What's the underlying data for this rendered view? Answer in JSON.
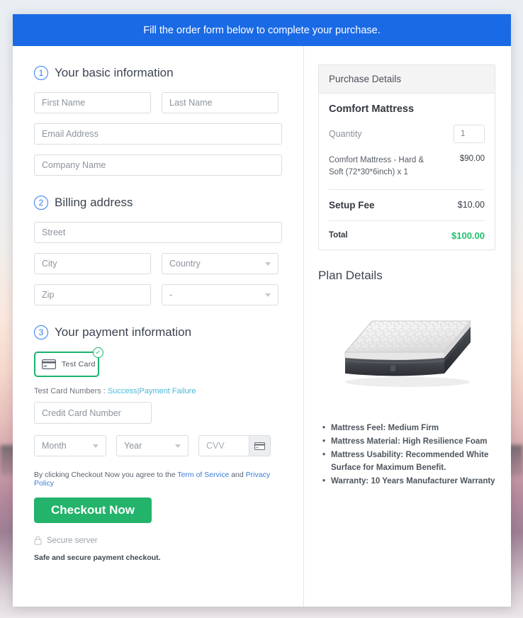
{
  "banner": {
    "text": "Fill the order form below to complete your purchase."
  },
  "steps": {
    "basic": {
      "number": "1",
      "title": "Your basic information"
    },
    "billing": {
      "number": "2",
      "title": "Billing address"
    },
    "payment": {
      "number": "3",
      "title": "Your payment information"
    }
  },
  "fields": {
    "first_name": {
      "placeholder": "First Name",
      "value": ""
    },
    "last_name": {
      "placeholder": "Last Name",
      "value": ""
    },
    "email": {
      "placeholder": "Email Address",
      "value": ""
    },
    "company": {
      "placeholder": "Company Name",
      "value": ""
    },
    "street": {
      "placeholder": "Street",
      "value": ""
    },
    "city": {
      "placeholder": "City",
      "value": ""
    },
    "country": {
      "placeholder": "Country",
      "value": ""
    },
    "zip": {
      "placeholder": "Zip",
      "value": ""
    },
    "state": {
      "placeholder": "-",
      "value": ""
    },
    "card_number": {
      "placeholder": "Credit Card Number",
      "value": ""
    },
    "month": {
      "placeholder": "Month",
      "value": ""
    },
    "year": {
      "placeholder": "Year",
      "value": ""
    },
    "cvv": {
      "placeholder": "CVV",
      "value": ""
    }
  },
  "payment": {
    "tile_label": "Test  Card",
    "tile_selected": true,
    "test_numbers_prefix": "Test Card Numbers :",
    "link_success": "Success",
    "separator": "|",
    "link_failure": "Payment Failure"
  },
  "terms": {
    "prefix": "By clicking Checkout Now you agree to the",
    "link_tos": "Term of Service",
    "conjunction": "and",
    "link_privacy": "Privacy Policy"
  },
  "actions": {
    "checkout_label": "Checkout Now",
    "secure_text": "Secure server",
    "safe_note": "Safe and secure payment checkout."
  },
  "purchase": {
    "header": "Purchase Details",
    "product_name": "Comfort Mattress",
    "quantity_label": "Quantity",
    "quantity_value": "1",
    "line_item": {
      "description": "Comfort Mattress - Hard & Soft (72*30*6inch) x 1",
      "amount": "$90.00"
    },
    "setup_fee": {
      "label": "Setup Fee",
      "amount": "$10.00"
    },
    "total": {
      "label": "Total",
      "amount": "$100.00"
    }
  },
  "plan": {
    "title": "Plan Details",
    "features": [
      "Mattress Feel: Medium Firm",
      "Mattress Material: High Resilience Foam",
      "Mattress Usability: Recommended White Surface for Maximum Benefit.",
      "Warranty: 10 Years Manufacturer Warranty"
    ]
  },
  "colors": {
    "banner_blue": "#1b6ae5",
    "step_blue": "#2f7bf0",
    "success_green": "#23b36b",
    "total_green": "#1fbf6e",
    "link_blue": "#3b7dd8",
    "link_cyan": "#46b8d8"
  }
}
